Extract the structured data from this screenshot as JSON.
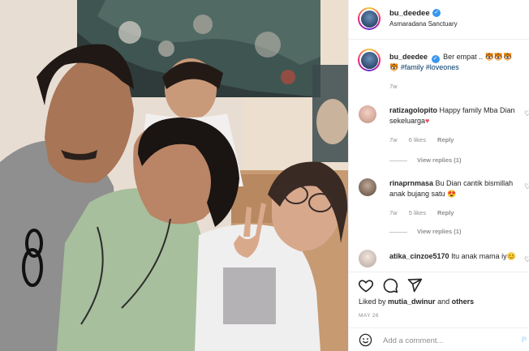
{
  "post": {
    "username": "bu_deedee",
    "location": "Asmaradana Sanctuary",
    "caption": {
      "text": "Ber empat .. 🐯🐯🐯",
      "emoji_line": "🐯",
      "hashtags": "#family #loveones",
      "age": "7w"
    },
    "likes_prefix": "Liked by",
    "likes_user": "mutia_dwinur",
    "likes_suffix": "and",
    "likes_others": "others",
    "date": "MAY 26"
  },
  "comments": [
    {
      "username": "ratizagolopito",
      "text": "Happy family Mba Dian sekeluarga",
      "emoji": "♥",
      "age": "7w",
      "likes": "6 likes",
      "reply": "Reply",
      "view_replies": "View replies (1)"
    },
    {
      "username": "rinaprnmasa",
      "text": "Bu Dian cantik bismillah anak bujang satu 😍",
      "age": "7w",
      "likes": "5 likes",
      "reply": "Reply",
      "view_replies": "View replies (1)"
    },
    {
      "username": "atika_cinzoe5170",
      "text": "Itu anak mama iy😊",
      "age": "",
      "likes": "",
      "reply": "",
      "view_replies": ""
    }
  ],
  "composer": {
    "placeholder": "Add a comment...",
    "post_label": "P"
  },
  "icons": {
    "like": "heart-outline-icon",
    "comment": "speech-bubble-icon",
    "share": "paper-plane-icon",
    "emoji": "smiley-icon"
  },
  "colors": {
    "verified": "#3897f0",
    "hashtag": "#00376b",
    "reply_heart": "#ed4956",
    "post_button": "#b2dffc"
  }
}
